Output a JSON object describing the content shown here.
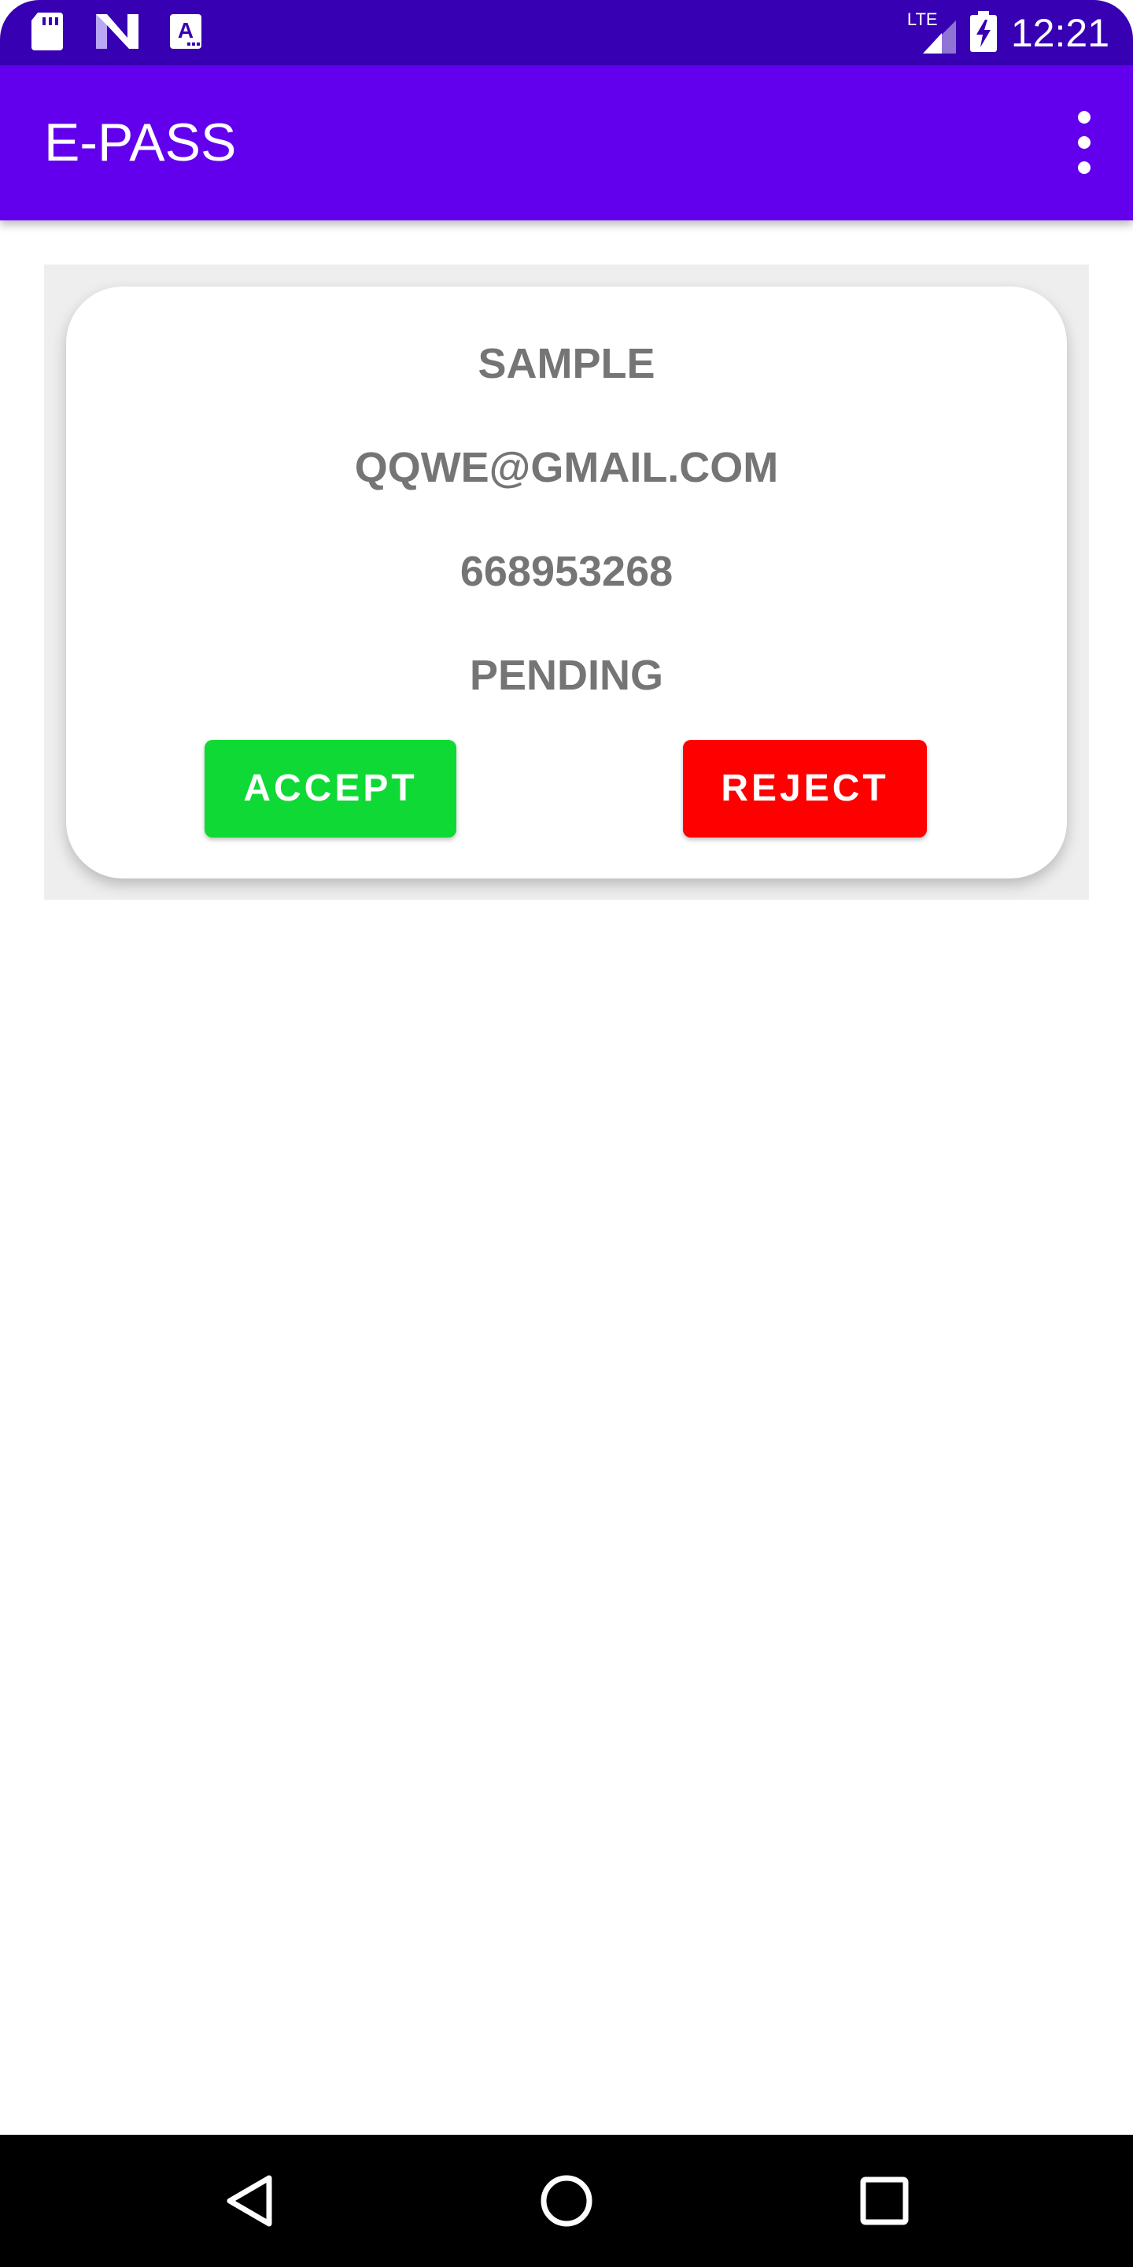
{
  "status_bar": {
    "time": "12:21",
    "network": "LTE",
    "left_icons": [
      "sd-card-icon",
      "n-logo-icon",
      "font-a-icon"
    ],
    "right_icons": [
      "lte-signal-icon",
      "battery-charging-icon"
    ],
    "background": "#3700b3"
  },
  "app_bar": {
    "title": "E-PASS",
    "menu_icon": "overflow-menu-icon",
    "background": "#6200ee"
  },
  "card": {
    "name": "SAMPLE",
    "email": "QQWE@GMAIL.COM",
    "phone": "668953268",
    "status": "PENDING",
    "accept_label": "ACCEPT",
    "reject_label": "REJECT",
    "accept_color": "#0fd934",
    "reject_color": "#ff0000",
    "text_color": "#757575"
  },
  "nav_bar": {
    "buttons": [
      "back-icon",
      "home-icon",
      "recents-icon"
    ]
  }
}
